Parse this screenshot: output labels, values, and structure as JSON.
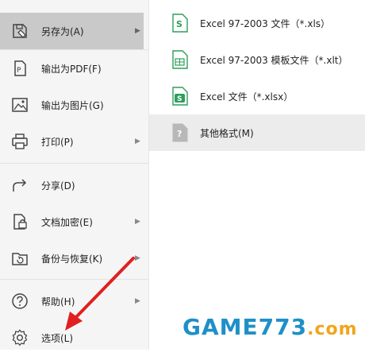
{
  "menu": {
    "items": [
      {
        "label": "另存为(A)",
        "icon": "save-as-icon",
        "submenu": true,
        "active": true
      },
      {
        "label": "输出为PDF(F)",
        "icon": "pdf-icon",
        "submenu": false
      },
      {
        "label": "输出为图片(G)",
        "icon": "image-icon",
        "submenu": false
      },
      {
        "label": "打印(P)",
        "icon": "printer-icon",
        "submenu": true
      },
      {
        "label": "分享(D)",
        "icon": "share-icon",
        "submenu": false
      },
      {
        "label": "文档加密(E)",
        "icon": "lock-file-icon",
        "submenu": true
      },
      {
        "label": "备份与恢复(K)",
        "icon": "backup-icon",
        "submenu": true
      },
      {
        "label": "帮助(H)",
        "icon": "help-icon",
        "submenu": true
      },
      {
        "label": "选项(L)",
        "icon": "gear-icon",
        "submenu": false
      }
    ]
  },
  "submenu": {
    "items": [
      {
        "label": "Excel 97-2003 文件（*.xls）",
        "icon": "xls-file-icon"
      },
      {
        "label": "Excel 97-2003 模板文件（*.xlt）",
        "icon": "xlt-file-icon"
      },
      {
        "label": "Excel 文件（*.xlsx）",
        "icon": "xlsx-file-icon"
      },
      {
        "label": "其他格式(M)",
        "icon": "unknown-file-icon",
        "highlight": true
      }
    ]
  },
  "watermark": {
    "text_a": "GAME",
    "text_b": "773",
    "text_c": ".com"
  },
  "colors": {
    "accent_green": "#2e9e5b",
    "arrow_red": "#e02020",
    "watermark_blue": "#1e90c8",
    "watermark_orange": "#f2a51c"
  }
}
